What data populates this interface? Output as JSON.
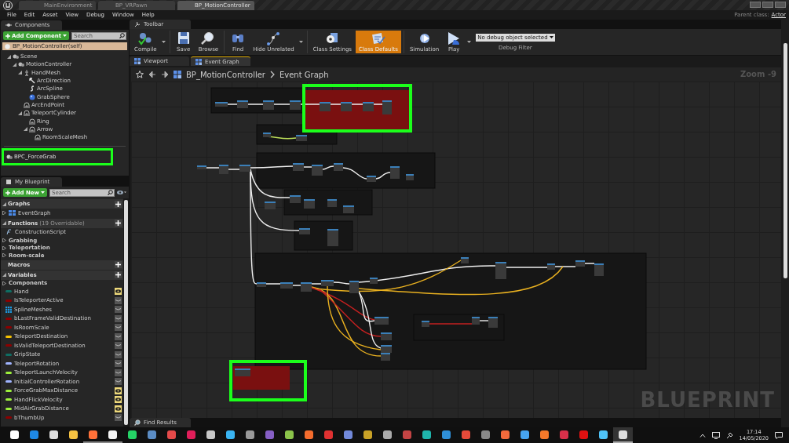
{
  "title_bar": {
    "tabs": [
      {
        "label": "MainEnvironment",
        "selected": false
      },
      {
        "label": "BP_VRPawn",
        "selected": false
      },
      {
        "label": "BP_MotionController",
        "selected": true
      }
    ]
  },
  "menu": [
    "File",
    "Edit",
    "Asset",
    "View",
    "Debug",
    "Window",
    "Help"
  ],
  "parent_class": {
    "label": "Parent class:",
    "value": "Actor"
  },
  "components_panel": {
    "tab": "Components",
    "add_label": "Add Component",
    "search": {
      "placeholder": "Search"
    },
    "self": "BP_MotionController(self)",
    "tree": [
      {
        "label": "Scene",
        "kind": "scene",
        "expanded": true,
        "children": [
          {
            "label": "MotionController",
            "kind": "scene",
            "expanded": true,
            "children": [
              {
                "label": "HandMesh",
                "kind": "skeletal",
                "expanded": true,
                "children": [
                  {
                    "label": "ArcDirection",
                    "kind": "arrow"
                  },
                  {
                    "label": "ArcSpline",
                    "kind": "spline"
                  },
                  {
                    "label": "GrabSphere",
                    "kind": "sphere"
                  }
                ]
              },
              {
                "label": "ArcEndPoint",
                "kind": "point"
              },
              {
                "label": "TeleportCylinder",
                "kind": "point",
                "expanded": true,
                "children": [
                  {
                    "label": "Ring",
                    "kind": "point"
                  },
                  {
                    "label": "Arrow",
                    "kind": "point",
                    "expanded": true,
                    "children": [
                      {
                        "label": "RoomScaleMesh",
                        "kind": "point"
                      }
                    ]
                  }
                ]
              }
            ]
          }
        ]
      }
    ],
    "actor_components": [
      {
        "label": "BPC_ForceGrab",
        "highlighted": true
      }
    ]
  },
  "toolbar": {
    "tab": "Toolbar",
    "buttons": [
      {
        "label": "Compile",
        "kind": "compile",
        "dropdown": true,
        "selected": false
      },
      {
        "label": "Save",
        "kind": "save",
        "selected": false
      },
      {
        "label": "Browse",
        "kind": "browse",
        "selected": false
      },
      {
        "label": "Find",
        "kind": "find",
        "selected": false
      },
      {
        "label": "Hide Unrelated",
        "kind": "hide",
        "dropdown": true,
        "selected": false
      },
      {
        "label": "Class Settings",
        "kind": "settings",
        "selected": false
      },
      {
        "label": "Class Defaults",
        "kind": "defaults",
        "selected": true
      },
      {
        "label": "Simulation",
        "kind": "simulation",
        "selected": false
      },
      {
        "label": "Play",
        "kind": "play",
        "dropdown": true,
        "selected": false
      }
    ],
    "debug": {
      "value": "No debug object selected",
      "label": "Debug Filter"
    }
  },
  "document_tabs": [
    {
      "label": "Viewport",
      "selected": false
    },
    {
      "label": "Event Graph",
      "selected": true
    }
  ],
  "graph": {
    "breadcrumb": [
      "BP_MotionController",
      "Event Graph"
    ],
    "zoom": "Zoom -9",
    "watermark": "BLUEPRINT"
  },
  "bottom_tab": "Find Results",
  "my_blueprint": {
    "tab": "My Blueprint",
    "add_label": "Add New",
    "search": {
      "placeholder": "Search"
    },
    "sections": [
      {
        "title": "Graphs",
        "expanded": true,
        "items": [
          {
            "label": "EventGraph",
            "kind": "graph"
          }
        ]
      },
      {
        "title": "Functions",
        "note": "(19 Overridable)",
        "expanded": true,
        "items": [
          {
            "label": "ConstructionScript",
            "kind": "function"
          },
          {
            "label": "Grabbing",
            "kind": "category"
          },
          {
            "label": "Teleportation",
            "kind": "category"
          },
          {
            "label": "Room-scale",
            "kind": "category"
          }
        ]
      },
      {
        "title": "Macros"
      },
      {
        "title": "Variables",
        "expanded": true,
        "items": [
          {
            "label": "Components",
            "kind": "category"
          },
          {
            "label": "Hand",
            "kind": "variable",
            "color": "#0e6e63",
            "public": true
          },
          {
            "label": "IsTeleporterActive",
            "kind": "variable",
            "color": "#8c0000",
            "public": false
          },
          {
            "label": "SplineMeshes",
            "kind": "array",
            "color": "#1e9ae0",
            "public": false
          },
          {
            "label": "bLastFrameValidDestination",
            "kind": "variable",
            "color": "#8c0000",
            "public": false
          },
          {
            "label": "IsRoomScale",
            "kind": "variable",
            "color": "#8c0000",
            "public": false
          },
          {
            "label": "TeleportDestination",
            "kind": "variable",
            "color": "#f7c200",
            "public": false
          },
          {
            "label": "IsValidTeleportDestination",
            "kind": "variable",
            "color": "#8c0000",
            "public": false
          },
          {
            "label": "GripState",
            "kind": "variable",
            "color": "#0e6e63",
            "public": false
          },
          {
            "label": "TeleportRotation",
            "kind": "variable",
            "color": "#a0b4ff",
            "public": false
          },
          {
            "label": "TeleportLaunchVelocity",
            "kind": "variable",
            "color": "#9df03c",
            "public": false
          },
          {
            "label": "InitialControllerRotation",
            "kind": "variable",
            "color": "#a0b4ff",
            "public": false
          },
          {
            "label": "ForceGrabMaxDistance",
            "kind": "variable",
            "color": "#9df03c",
            "public": true
          },
          {
            "label": "HandFlickVelocity",
            "kind": "variable",
            "color": "#9df03c",
            "public": true
          },
          {
            "label": "MidAirGrabDistance",
            "kind": "variable",
            "color": "#9df03c",
            "public": true
          },
          {
            "label": "bThumbUp",
            "kind": "variable",
            "color": "#8c0000",
            "public": false
          }
        ]
      }
    ]
  },
  "taskbar": {
    "apps": [
      {
        "color": "#ffffff",
        "running": false
      },
      {
        "color": "#1e88e5",
        "running": false
      },
      {
        "color": "#dddddd",
        "running": false
      },
      {
        "color": "#f5c242",
        "running": false
      },
      {
        "color": "#ff7139",
        "running": true
      },
      {
        "color": "#f4f4f4",
        "running": true
      },
      {
        "color": "#25d366",
        "running": false
      },
      {
        "color": "#5b8cc4",
        "running": false
      },
      {
        "color": "#e44a4a",
        "running": false
      },
      {
        "color": "#e01e5a",
        "running": false
      },
      {
        "color": "#c8c8c8",
        "running": false
      },
      {
        "color": "#3ab4f2",
        "running": false
      },
      {
        "color": "#9a9a9a",
        "running": false
      },
      {
        "color": "#865fc5",
        "running": false
      },
      {
        "color": "#8bc34a",
        "running": false
      },
      {
        "color": "#f56c2d",
        "running": false
      },
      {
        "color": "#e03131",
        "running": false
      },
      {
        "color": "#7289da",
        "running": false
      },
      {
        "color": "#c9a227",
        "running": false
      },
      {
        "color": "#aaaaaa",
        "running": false
      },
      {
        "color": "#c44444",
        "running": false
      },
      {
        "color": "#1fb5ac",
        "running": false
      },
      {
        "color": "#2f8fd8",
        "running": false
      },
      {
        "color": "#e84a3a",
        "running": false
      },
      {
        "color": "#888888",
        "running": false
      },
      {
        "color": "#f26a3c",
        "running": false
      },
      {
        "color": "#47a4f0",
        "running": false
      },
      {
        "color": "#f5792a",
        "running": false
      },
      {
        "color": "#d8304a",
        "running": false
      },
      {
        "color": "#e11111",
        "running": false
      },
      {
        "color": "#4fc3f7",
        "running": false
      },
      {
        "color": "#dddddd",
        "running": true,
        "active": true
      }
    ],
    "time": "17:14",
    "date": "14/05/2020"
  }
}
